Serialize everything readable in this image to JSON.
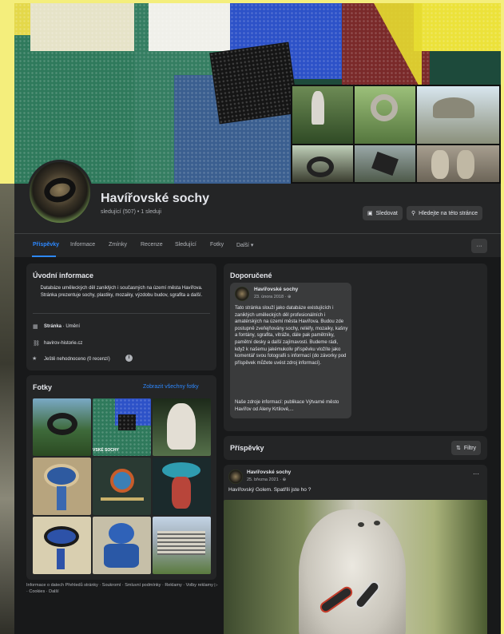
{
  "page": {
    "name": "Havířovské sochy",
    "followers_line": "sledující (507) • 1 sleduji"
  },
  "actions": {
    "follow_label": "Sledovat",
    "search_label": "Hledejte na této stránce",
    "more_label": "···"
  },
  "tabs": [
    {
      "label": "Příspěvky"
    },
    {
      "label": "Informace"
    },
    {
      "label": "Zmínky"
    },
    {
      "label": "Recenze"
    },
    {
      "label": "Sledující"
    },
    {
      "label": "Fotky"
    },
    {
      "label": "Další ▾"
    }
  ],
  "intro": {
    "title": "Úvodní informace",
    "description": "Databáze uměleckých děl zaniklých i současných na území města Havířova. Stránka prezentuje sochy, plastiky, mozaiky, výzdobu budov, sgrafita a další.",
    "category_bold": "Stránka",
    "category_rest": " · Umění",
    "website": "havirov-historie.cz",
    "rating": "Ještě nehodnoceno (0 recenzí)"
  },
  "photos": {
    "title": "Fotky",
    "link": "Zobrazit všechny fotky",
    "overlay_label": "VSKÉ SOCHY"
  },
  "featured": {
    "title": "Doporučené",
    "author": "Havířovské sochy",
    "date": "23. února 2018 · ⊕",
    "text": "Tato stránka slouží jako databáze existujících i zaniklých uměleckých děl profesionálních i amatérských na území města Havířova. Budou zde postupně zveřejňovány sochy, reliéfy, mozaiky, kašny a fontány, sgrafita, vitráže, dále pak pamětníky, pamětní desky a další zajímavosti. Budeme rádi, když k našemu jakémukoliv příspěvku vložíte jako komentář svou fotografii s informací (do závorky pod příspěvek můžete uvést zdroj informací).",
    "text2": "Naše zdroje informací: publikace Výtvarné město Havířov od Aleny Krtilové,..."
  },
  "posts": {
    "title": "Příspěvky",
    "filter_label": "Filtry",
    "post": {
      "author": "Havířovské sochy",
      "date": "25. března 2021 · ⊕",
      "text": "Havířovský Golem. Spatříli jste ho ?",
      "menu": "···"
    }
  },
  "footer": {
    "text": "Informace o datech Přehledů stránky · Soukromí · Smluvní podmínky · Reklamy · Volby reklamy ▷ · Cookies · Další"
  },
  "colors": {
    "accent": "#2d88ff",
    "surface": "#242526",
    "background": "#18191a"
  }
}
